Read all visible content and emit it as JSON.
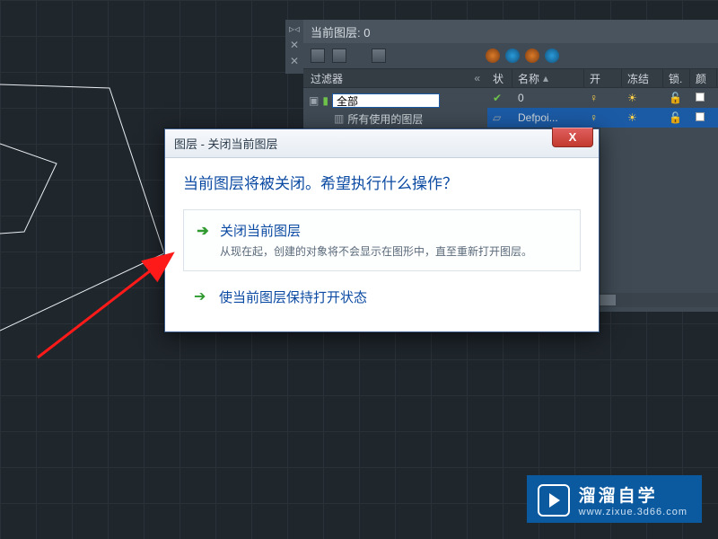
{
  "panel": {
    "current_layer_label": "当前图层: 0",
    "filter_header": "过滤器",
    "filter_root": "全部",
    "filter_used": "所有使用的图层",
    "cols": {
      "stat": "状",
      "name": "名称",
      "on": "开",
      "freeze": "冻结",
      "lock": "锁.",
      "color": "颜"
    },
    "layers": [
      {
        "name": "0",
        "checked": true,
        "selected": false
      },
      {
        "name": "Defpoi...",
        "checked": false,
        "selected": true
      }
    ]
  },
  "dialog": {
    "title": "图层 - 关闭当前图层",
    "question": "当前图层将被关闭。希望执行什么操作？",
    "opt1_title": "关闭当前图层",
    "opt1_desc": "从现在起，创建的对象将不会显示在图形中，直至重新打开图层。",
    "opt2_title": "使当前图层保持打开状态",
    "close_x": "X"
  },
  "watermark": {
    "name": "溜溜自学",
    "url": "www.zixue.3d66.com"
  }
}
